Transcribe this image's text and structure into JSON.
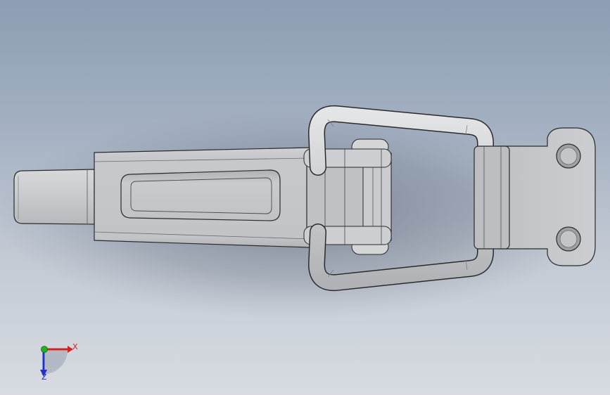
{
  "viewport": {
    "background_top": "#8d9db3",
    "background_bottom": "#d8dce2"
  },
  "model": {
    "part_color": "#c4c6c9",
    "edge_color": "#2a2a2a"
  },
  "triad": {
    "x_label": "X",
    "z_label": "Z",
    "x_color": "#d42020",
    "y_color": "#20b020",
    "z_color": "#2030c8"
  }
}
